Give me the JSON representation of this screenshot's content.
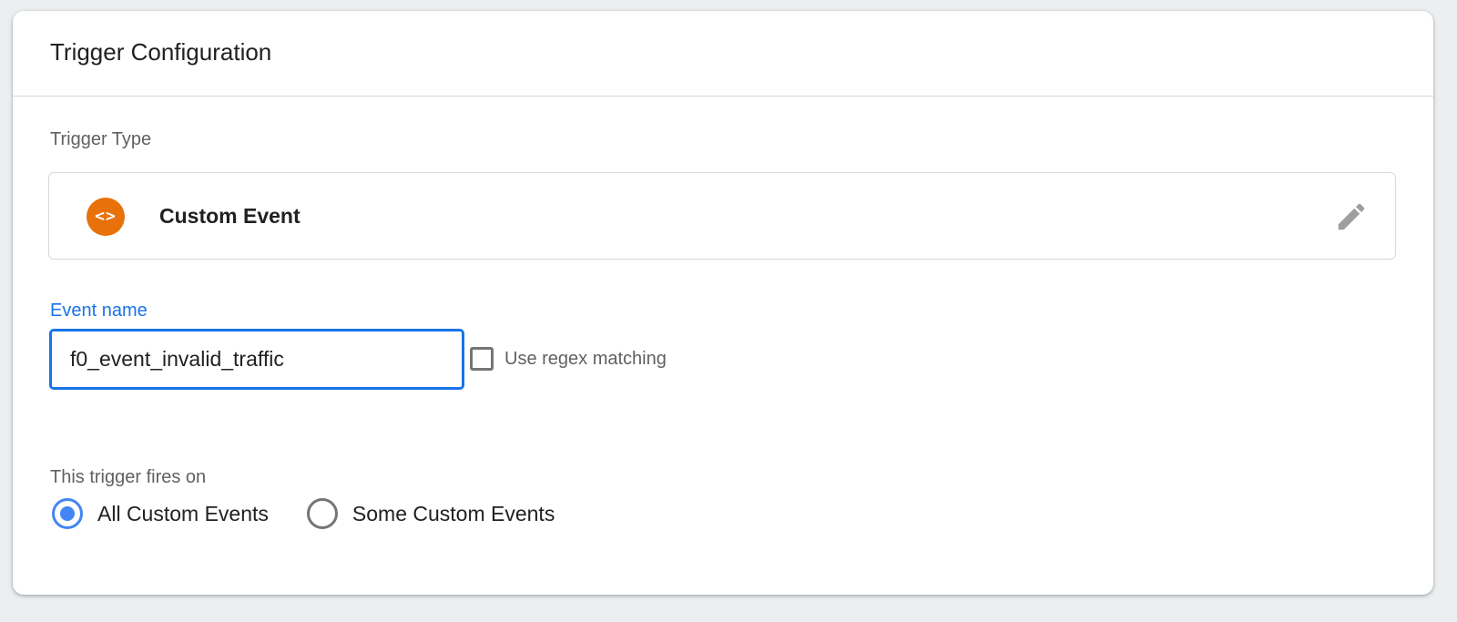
{
  "card": {
    "title": "Trigger Configuration"
  },
  "trigger_type": {
    "label": "Trigger Type",
    "name": "Custom Event",
    "icon": "code-brackets-icon",
    "icon_glyph": "<>",
    "icon_color": "#e8710a"
  },
  "event_name": {
    "label": "Event name",
    "value": "f0_event_invalid_traffic",
    "accent_color": "#1a73e8"
  },
  "regex": {
    "label": "Use regex matching",
    "checked": false
  },
  "fires_on": {
    "label": "This trigger fires on",
    "options": [
      {
        "label": "All Custom Events",
        "selected": true
      },
      {
        "label": "Some Custom Events",
        "selected": false
      }
    ]
  }
}
